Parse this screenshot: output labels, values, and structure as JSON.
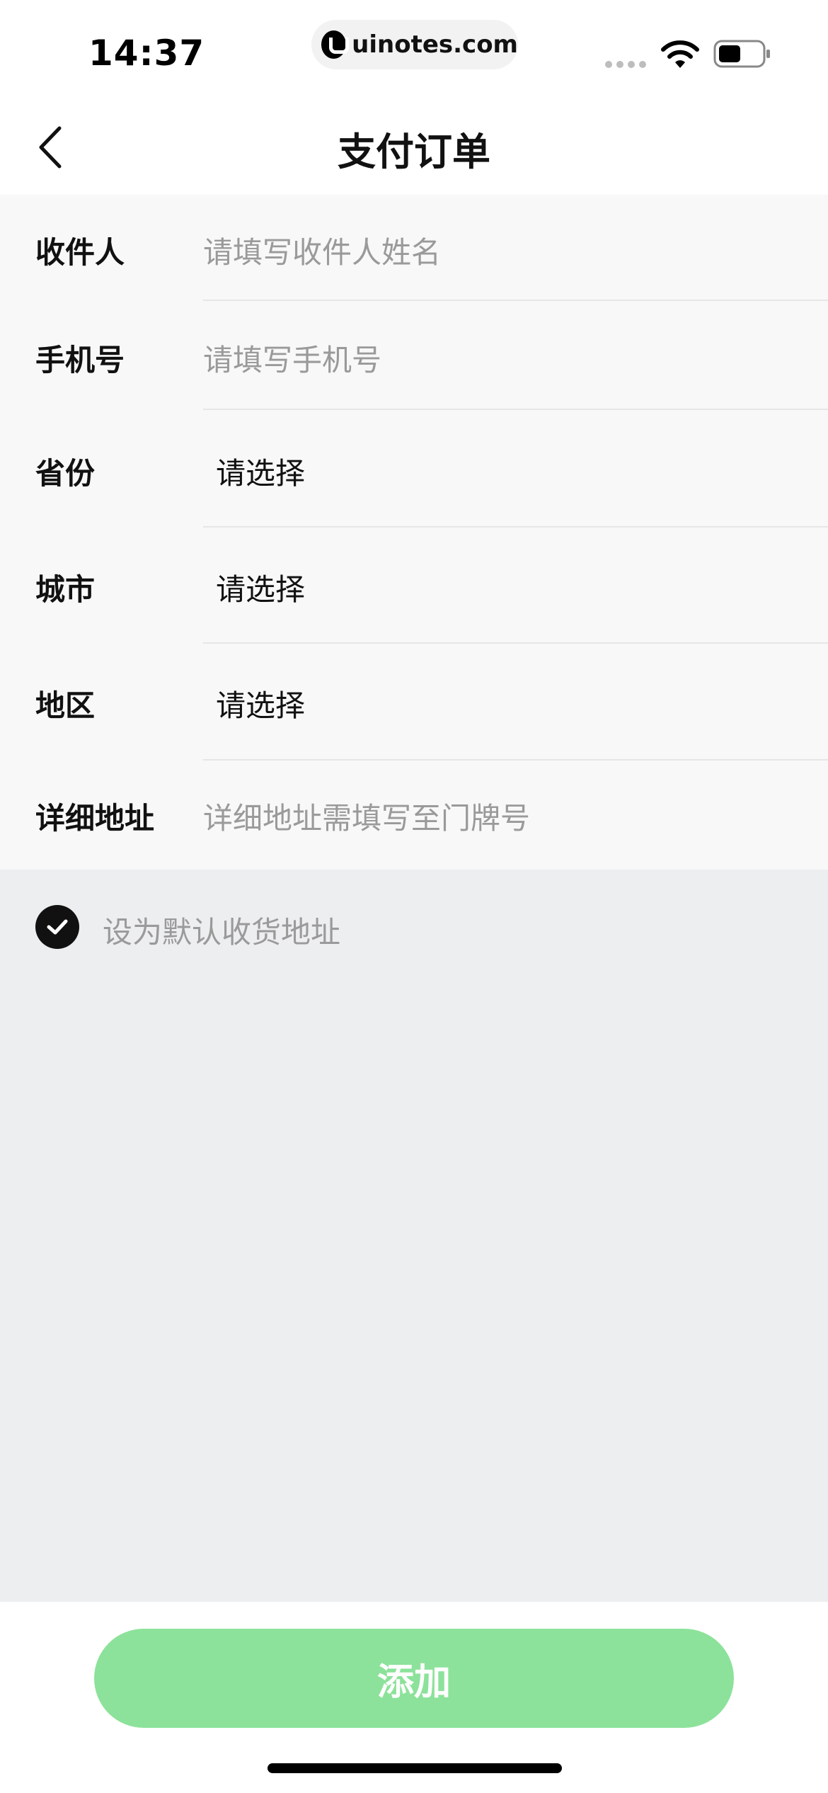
{
  "status_bar": {
    "time": "14:37",
    "url": "uinotes.com",
    "icons": [
      "signal-dots-icon",
      "wifi-icon",
      "battery-icon"
    ]
  },
  "nav": {
    "title": "支付订单",
    "back_icon": "chevron-left-icon"
  },
  "form": {
    "recipient": {
      "label": "收件人",
      "placeholder": "请填写收件人姓名"
    },
    "phone": {
      "label": "手机号",
      "placeholder": "请填写手机号"
    },
    "province": {
      "label": "省份",
      "value": "请选择"
    },
    "city": {
      "label": "城市",
      "value": "请选择"
    },
    "district": {
      "label": "地区",
      "value": "请选择"
    },
    "address": {
      "label": "详细地址",
      "placeholder": "详细地址需填写至门牌号"
    }
  },
  "default_address": {
    "label": "设为默认收货地址",
    "checked": true
  },
  "footer": {
    "add_label": "添加"
  },
  "colors": {
    "accent": "#8ce29a",
    "form_bg": "#f8f8f8",
    "page_bg": "#edeef0",
    "placeholder": "#9a9a9a"
  }
}
